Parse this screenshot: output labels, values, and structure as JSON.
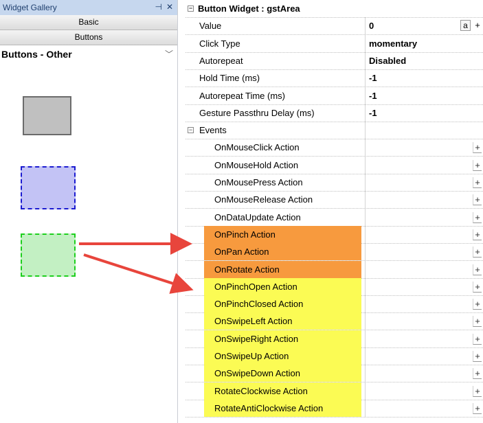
{
  "gallery": {
    "title": "Widget Gallery",
    "pin_icon": "pin-icon",
    "close_icon": "close-icon",
    "tabs": [
      "Basic",
      "Buttons"
    ],
    "category": "Buttons - Other",
    "samples": [
      {
        "name": "gray-button-sample",
        "fill": "#c0c0c0",
        "border": "#6b6b6b",
        "style": "solid"
      },
      {
        "name": "blue-dashed-button-sample",
        "fill": "#c3c3f5",
        "border": "#1a1ad0",
        "style": "dashed"
      },
      {
        "name": "green-dashed-button-sample",
        "fill": "#c3f0c3",
        "border": "#1ccf1c",
        "style": "dashed"
      }
    ]
  },
  "grid": {
    "title": "Button Widget : gstArea",
    "properties": [
      {
        "label": "Value",
        "value": "0"
      },
      {
        "label": "Click Type",
        "value": "momentary"
      },
      {
        "label": "Autorepeat",
        "value": "Disabled"
      },
      {
        "label": "Hold Time (ms)",
        "value": "-1"
      },
      {
        "label": "Autorepeat Time (ms)",
        "value": "-1"
      },
      {
        "label": "Gesture Passthru Delay (ms)",
        "value": "-1"
      }
    ],
    "value_buttons": [
      "a",
      "+"
    ],
    "events_title": "Events",
    "events": [
      {
        "label": "OnMouseClick Action",
        "highlight": ""
      },
      {
        "label": "OnMouseHold Action",
        "highlight": ""
      },
      {
        "label": "OnMousePress Action",
        "highlight": ""
      },
      {
        "label": "OnMouseRelease Action",
        "highlight": ""
      },
      {
        "label": "OnDataUpdate Action",
        "highlight": ""
      },
      {
        "label": "OnPinch Action",
        "highlight": "#f79a3e"
      },
      {
        "label": "OnPan Action",
        "highlight": "#f79a3e"
      },
      {
        "label": "OnRotate Action",
        "highlight": "#f79a3e"
      },
      {
        "label": "OnPinchOpen Action",
        "highlight": "#fbfb54"
      },
      {
        "label": "OnPinchClosed Action",
        "highlight": "#fbfb54"
      },
      {
        "label": "OnSwipeLeft Action",
        "highlight": "#fbfb54"
      },
      {
        "label": "OnSwipeRight Action",
        "highlight": "#fbfb54"
      },
      {
        "label": "OnSwipeUp Action",
        "highlight": "#fbfb54"
      },
      {
        "label": "OnSwipeDown Action",
        "highlight": "#fbfb54"
      },
      {
        "label": "RotateClockwise Action",
        "highlight": "#fbfb54"
      },
      {
        "label": "RotateAntiClockwise Action",
        "highlight": "#fbfb54"
      }
    ],
    "add_label": "+",
    "expand_glyph": "⊟"
  },
  "annotation": {
    "arrow_color": "#e8453c"
  }
}
